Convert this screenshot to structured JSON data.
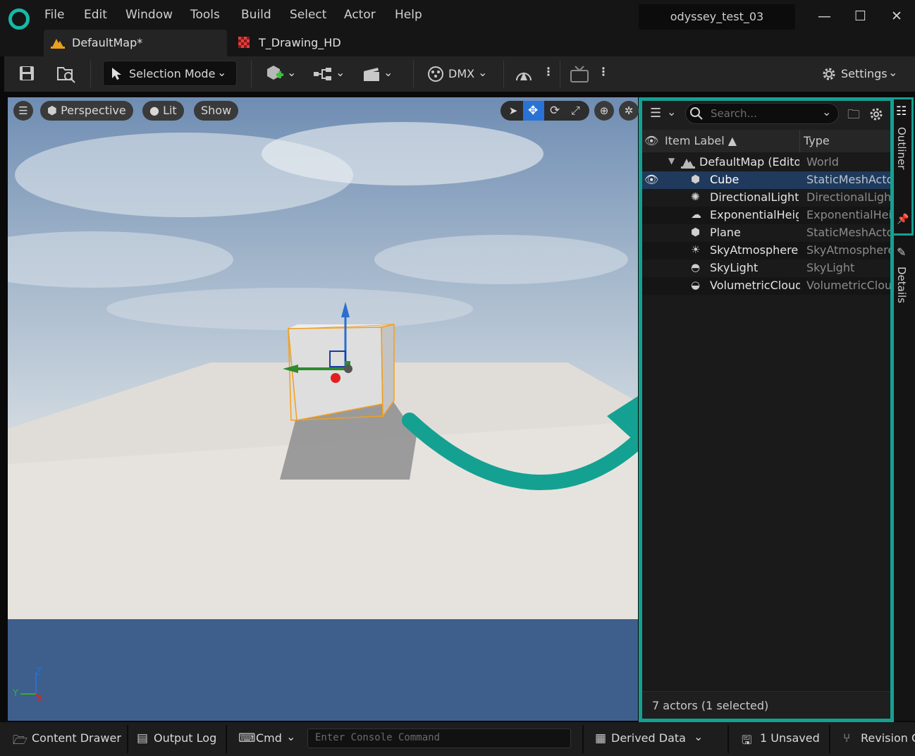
{
  "menubar": {
    "items": [
      "File",
      "Edit",
      "Window",
      "Tools",
      "Build",
      "Select",
      "Actor",
      "Help"
    ],
    "project": "odyssey_test_03"
  },
  "tabs": [
    {
      "label": "DefaultMap*",
      "active": true,
      "icon": "level-icon"
    },
    {
      "label": "T_Drawing_HD",
      "active": false,
      "icon": "texture-icon"
    }
  ],
  "toolbar": {
    "selection_mode": "Selection Mode",
    "dmx": "DMX",
    "settings": "Settings"
  },
  "viewport": {
    "view_mode": "Perspective",
    "lighting": "Lit",
    "show": "Show",
    "axis": {
      "z": "Z",
      "y": "Y",
      "x": "X"
    }
  },
  "outliner": {
    "search_placeholder": "Search...",
    "columns": {
      "label": "Item Label ▲",
      "type": "Type"
    },
    "rows": [
      {
        "label": "DefaultMap (Editor)",
        "type": "World",
        "icon": "world-icon",
        "indent": 0,
        "selected": false
      },
      {
        "label": "Cube",
        "type": "StaticMeshActor",
        "icon": "static-mesh-icon",
        "indent": 1,
        "selected": true
      },
      {
        "label": "DirectionalLight",
        "type": "DirectionalLight",
        "icon": "directional-light-icon",
        "indent": 1,
        "selected": false
      },
      {
        "label": "ExponentialHeightFog",
        "type": "ExponentialHeightFog",
        "icon": "fog-icon",
        "indent": 1,
        "selected": false
      },
      {
        "label": "Plane",
        "type": "StaticMeshActor",
        "icon": "static-mesh-icon",
        "indent": 1,
        "selected": false
      },
      {
        "label": "SkyAtmosphere",
        "type": "SkyAtmosphere",
        "icon": "sky-atmosphere-icon",
        "indent": 1,
        "selected": false
      },
      {
        "label": "SkyLight",
        "type": "SkyLight",
        "icon": "sky-light-icon",
        "indent": 1,
        "selected": false
      },
      {
        "label": "VolumetricCloud",
        "type": "VolumetricCloud",
        "icon": "cloud-icon",
        "indent": 1,
        "selected": false
      }
    ],
    "footer": "7 actors (1 selected)"
  },
  "side_tabs": {
    "outliner": "Outliner",
    "details": "Details"
  },
  "statusbar": {
    "content_drawer": "Content Drawer",
    "output_log": "Output Log",
    "cmd": "Cmd",
    "console_placeholder": "Enter Console Command",
    "derived_data": "Derived Data",
    "unsaved": "1 Unsaved",
    "revision": "Revision Control"
  },
  "colors": {
    "accent_teal": "#14a192",
    "selection_orange": "#f0a020",
    "selected_row": "#1f3a5c"
  }
}
